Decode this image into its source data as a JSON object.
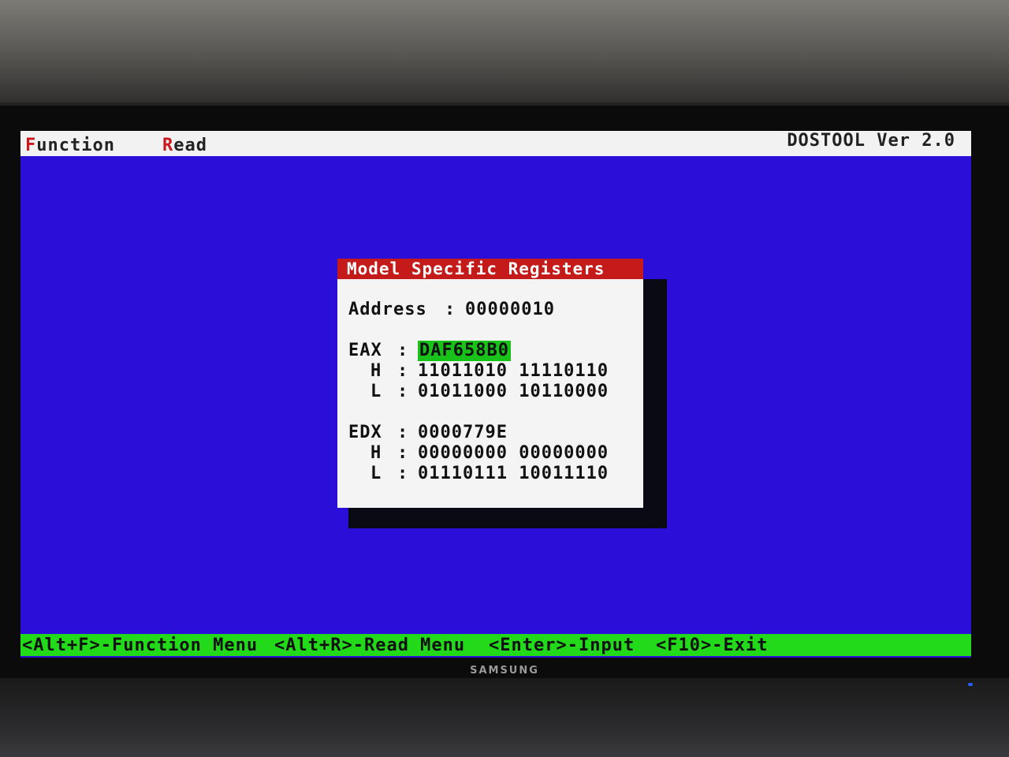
{
  "menubar": {
    "function_hotkey": "F",
    "function_rest": "unction",
    "read_hotkey": "R",
    "read_rest": "ead",
    "app_title": "DOSTOOL Ver 2.0"
  },
  "dialog": {
    "title": "Model Specific Registers",
    "address_label": "Address",
    "address_value": "00000010",
    "eax_label": "EAX",
    "eax_value": "DAF658B0",
    "eax_h_label": "H",
    "eax_h_value": "11011010 11110110",
    "eax_l_label": "L",
    "eax_l_value": "01011000 10110000",
    "edx_label": "EDX",
    "edx_value": "0000779E",
    "edx_h_label": "H",
    "edx_h_value": "00000000 00000000",
    "edx_l_label": "L",
    "edx_l_value": "01110111 10011110",
    "separator": ":"
  },
  "statusbar": {
    "items": [
      "<Alt+F>-Function Menu",
      "<Alt+R>-Read Menu",
      "<Enter>-Input",
      "<F10>-Exit"
    ]
  },
  "monitor": {
    "brand": "SAMSUNG"
  },
  "colors": {
    "screen_bg": "#2b0fd9",
    "dialog_title_bg": "#c41a1a",
    "highlight": "#19c219",
    "statusbar_bg": "#22d91a",
    "hotkey": "#c8181c"
  }
}
